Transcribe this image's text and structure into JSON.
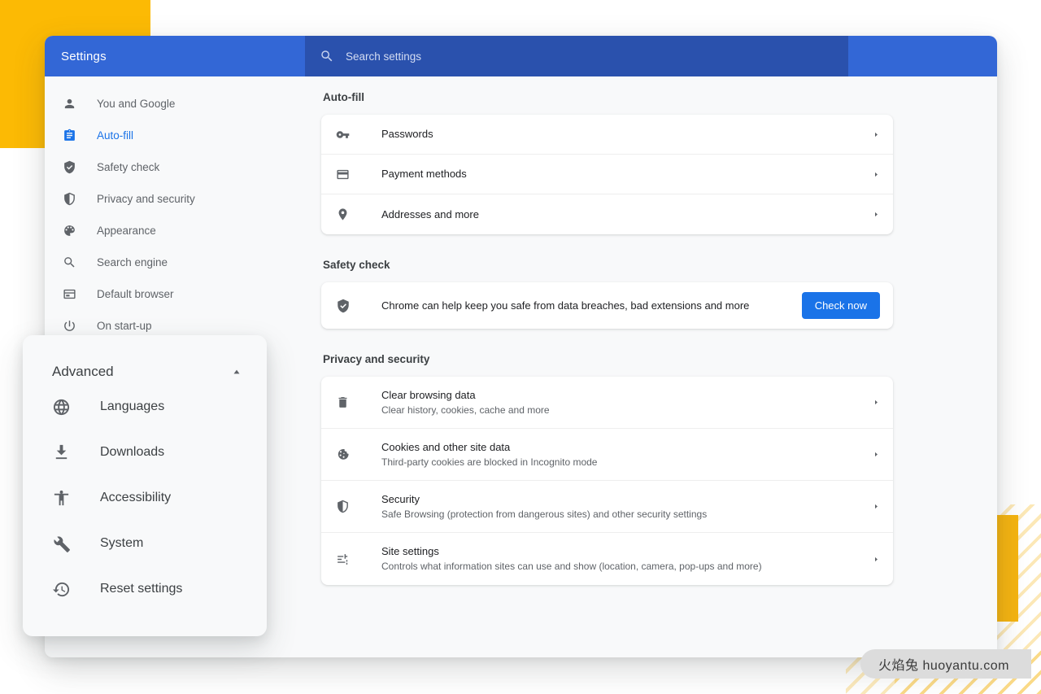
{
  "window": {
    "header": {
      "title": "Settings",
      "search": {
        "icon": "search-icon",
        "placeholder": "Search settings",
        "value": ""
      }
    }
  },
  "sidebar": {
    "items": [
      {
        "label": "You and Google",
        "icon": "person-icon",
        "active": false
      },
      {
        "label": "Auto-fill",
        "icon": "clipboard-icon",
        "active": true
      },
      {
        "label": "Safety check",
        "icon": "shield-check-icon",
        "active": false
      },
      {
        "label": "Privacy and security",
        "icon": "shield-half-icon",
        "active": false
      },
      {
        "label": "Appearance",
        "icon": "palette-icon",
        "active": false
      },
      {
        "label": "Search engine",
        "icon": "search-icon",
        "active": false
      },
      {
        "label": "Default browser",
        "icon": "browser-window-icon",
        "active": false
      },
      {
        "label": "On start-up",
        "icon": "power-icon",
        "active": false
      }
    ]
  },
  "content": {
    "sections": [
      {
        "title": "Auto-fill",
        "kind": "list",
        "rows": [
          {
            "title": "Passwords",
            "sub": "",
            "icon": "key-icon",
            "arrow": true
          },
          {
            "title": "Payment methods",
            "sub": "",
            "icon": "credit-card-icon",
            "arrow": true
          },
          {
            "title": "Addresses and more",
            "sub": "",
            "icon": "location-pin-icon",
            "arrow": true
          }
        ]
      },
      {
        "title": "Safety check",
        "kind": "safety",
        "icon": "shield-check-icon",
        "message": "Chrome can help keep you safe from data breaches, bad extensions and more",
        "button_label": "Check now"
      },
      {
        "title": "Privacy and security",
        "kind": "list",
        "rows": [
          {
            "title": "Clear browsing data",
            "sub": "Clear history, cookies, cache and more",
            "icon": "trash-icon",
            "arrow": true
          },
          {
            "title": "Cookies and other site data",
            "sub": "Third-party cookies are blocked in Incognito mode",
            "icon": "cookie-icon",
            "arrow": true
          },
          {
            "title": "Security",
            "sub": "Safe Browsing (protection from dangerous sites) and other security settings",
            "icon": "shield-half-icon",
            "arrow": true
          },
          {
            "title": "Site settings",
            "sub": "Controls what information sites can use and show (location, camera, pop-ups and more)",
            "icon": "sliders-icon",
            "arrow": true
          }
        ]
      }
    ]
  },
  "advanced_panel": {
    "title": "Advanced",
    "toggle_icon": "chevron-up-icon",
    "expanded": true,
    "items": [
      {
        "label": "Languages",
        "icon": "globe-icon"
      },
      {
        "label": "Downloads",
        "icon": "download-icon"
      },
      {
        "label": "Accessibility",
        "icon": "accessibility-icon"
      },
      {
        "label": "System",
        "icon": "wrench-icon"
      },
      {
        "label": "Reset settings",
        "icon": "history-restore-icon"
      }
    ]
  },
  "watermark": {
    "text": "火焰兔 huoyantu.com"
  },
  "colors": {
    "header_blue": "#3367D6",
    "search_blue": "#2A51AD",
    "accent_blue": "#1A73E8",
    "decor_yellow": "#FCBA04",
    "page_bg": "#F8F9FA",
    "card_white": "#FFFFFF",
    "text_primary": "#202124",
    "text_secondary": "#5F6368"
  }
}
